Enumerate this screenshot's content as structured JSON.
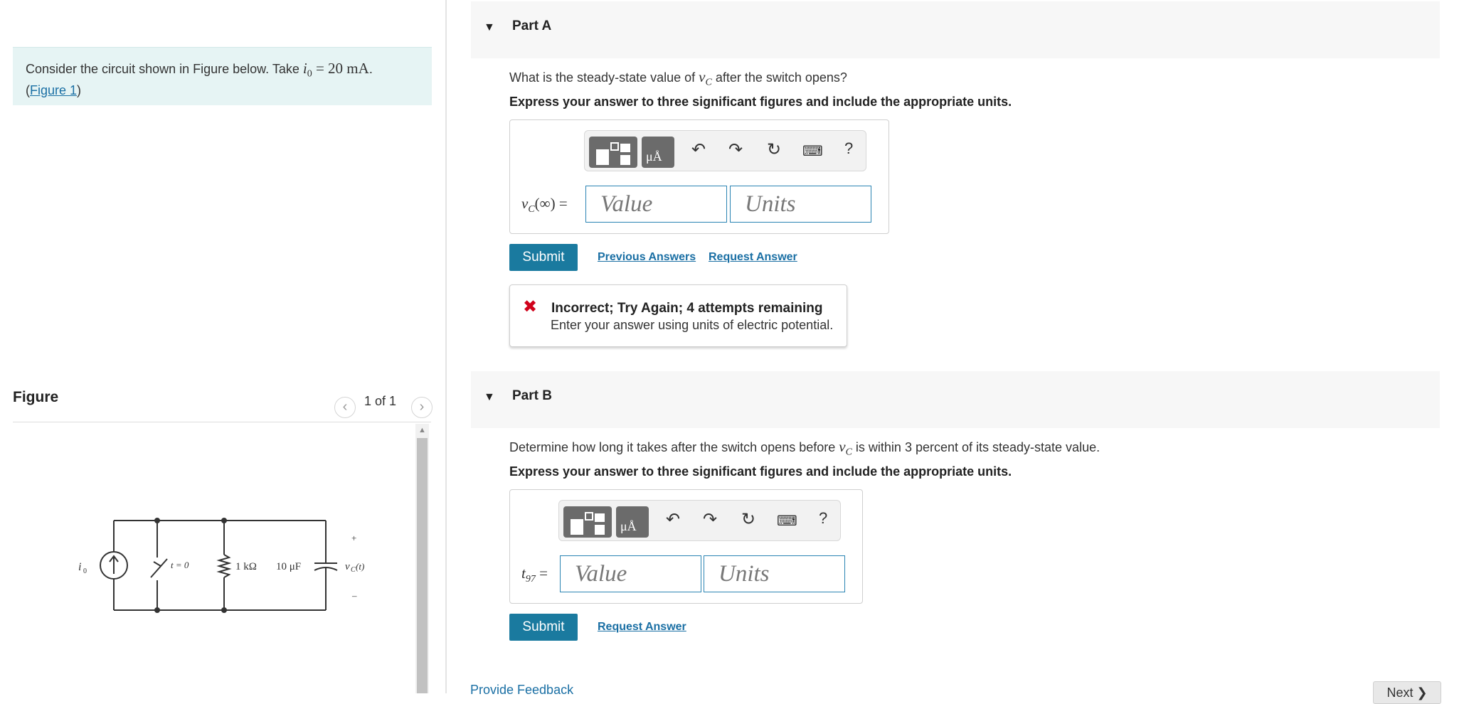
{
  "intro": {
    "text_before": "Consider the circuit shown in Figure below. Take ",
    "math_var": "i",
    "math_sub": "0",
    "math_eq": " = 20 mA",
    "text_after": ".",
    "link_open": "(",
    "figure_link": "Figure 1",
    "link_close": ")"
  },
  "figure": {
    "title": "Figure",
    "count": "1 of 1",
    "labels": {
      "source": "i",
      "source_sub": "0",
      "switch": "t = 0",
      "resistor": "1 kΩ",
      "capacitor": "10 μF",
      "vc": "v",
      "vc_sub": "C",
      "vc_paren": "(t)",
      "plus": "+",
      "minus": "–"
    }
  },
  "partA": {
    "label": "Part A",
    "question_before": "What is the steady-state value of ",
    "question_var": "v",
    "question_sub": "C",
    "question_after": " after the switch opens?",
    "instruction": "Express your answer to three significant figures and include the appropriate units.",
    "var_label": "v",
    "var_sub": "C",
    "var_rest": "(∞) =",
    "value_placeholder": "Value",
    "units_placeholder": "Units",
    "submit": "Submit",
    "previous_answers": "Previous Answers",
    "request_answer": "Request Answer",
    "feedback_title": "Incorrect; Try Again; 4 attempts remaining",
    "feedback_msg": "Enter your answer using units of electric potential."
  },
  "partB": {
    "label": "Part B",
    "question_before": "Determine how long it takes after the switch opens before ",
    "question_var": "v",
    "question_sub": "C",
    "question_after": " is within 3 percent of its steady-state value.",
    "instruction": "Express your answer to three significant figures and include the appropriate units.",
    "var_label": "t",
    "var_sub": "97",
    "var_rest": " =",
    "value_placeholder": "Value",
    "units_placeholder": "Units",
    "submit": "Submit",
    "request_answer": "Request Answer"
  },
  "toolbar": {
    "units_icon": "μÅ",
    "help": "?"
  },
  "footer": {
    "provide_feedback": "Provide Feedback",
    "next": "Next ❯"
  },
  "colors": {
    "intro_bg": "#e6f4f4",
    "accent": "#1a7a9f",
    "link": "#1a6fa4",
    "error": "#d0021b"
  }
}
